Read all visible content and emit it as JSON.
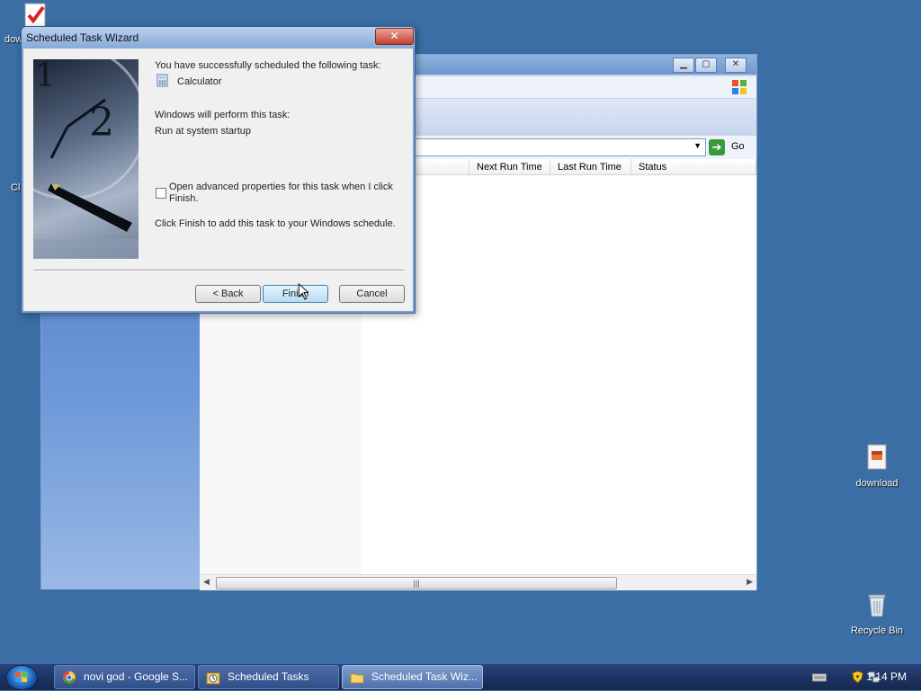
{
  "desktop": {
    "icons": [
      {
        "label": "dow"
      },
      {
        "label": "Cl"
      },
      {
        "label": "download"
      },
      {
        "label": "Recycle Bin"
      }
    ]
  },
  "background_window": {
    "columns": [
      "Next Run Time",
      "Last Run Time",
      "Status"
    ],
    "go_label": "Go"
  },
  "wizard": {
    "title": "Scheduled Task Wizard",
    "close_label": "✕",
    "success_text": "You have successfully scheduled the following task:",
    "task_name": "Calculator",
    "perform_text": "Windows will perform this task:",
    "schedule_text": "Run at system startup",
    "advanced_label_line1": "Open advanced properties for this task when I click",
    "advanced_label_line2": "Finish.",
    "advanced_checked": false,
    "finish_hint": "Click Finish to add this task to your Windows schedule.",
    "back_label": "< Back",
    "finish_label": "Finish",
    "cancel_label": "Cancel"
  },
  "taskbar": {
    "items": [
      {
        "label": "novi god - Google S...",
        "icon": "chrome-icon"
      },
      {
        "label": "Scheduled Tasks",
        "icon": "scheduled-tasks-icon"
      },
      {
        "label": "Scheduled Task Wiz...",
        "icon": "folder-icon",
        "active": true
      }
    ],
    "clock": "1:14 PM"
  }
}
